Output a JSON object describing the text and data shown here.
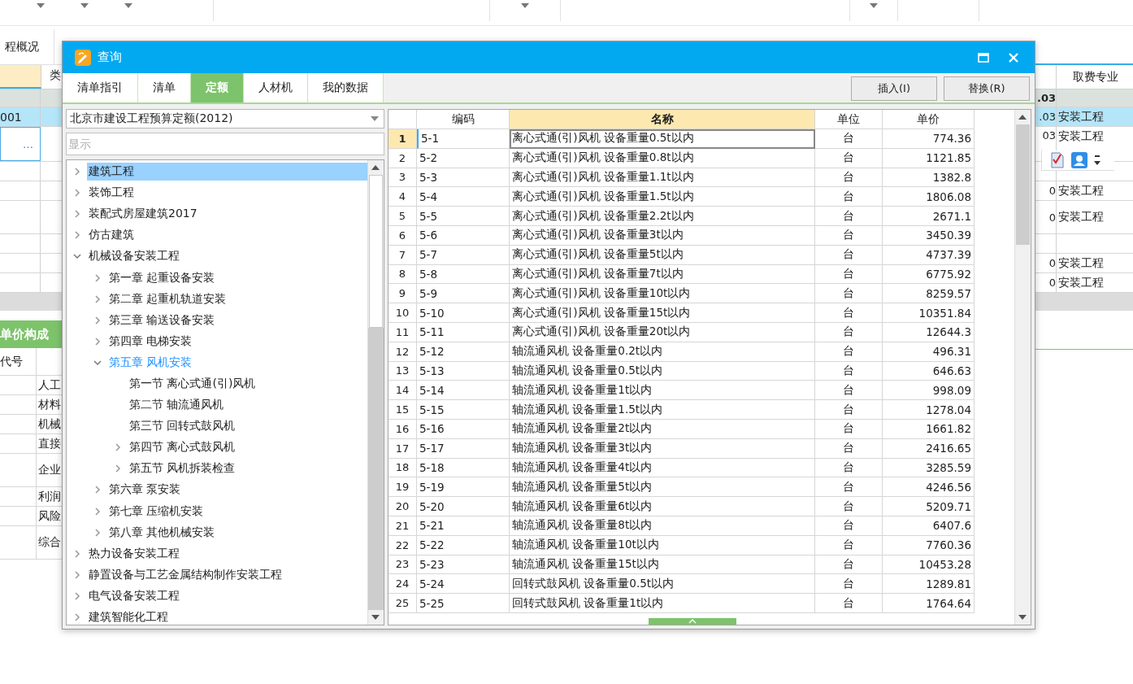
{
  "background": {
    "tab": "程概况",
    "left_header": "类",
    "right_header": "取费专业",
    "rows": [
      {
        "kind": "group",
        "selected": false,
        "right_number": ".03"
      },
      {
        "kind": "item",
        "selected": true,
        "left_cell": "001",
        "right_number": ".03",
        "right_specialty": "安装工程"
      },
      {
        "kind": "edit",
        "selected": false,
        "left_cell": "…",
        "right_number": "03",
        "right_specialty": "安装工程"
      },
      {
        "kind": "item",
        "selected": false
      },
      {
        "kind": "item",
        "selected": false,
        "right_number": "0",
        "right_specialty": "安装工程"
      },
      {
        "kind": "tall",
        "selected": false,
        "right_number": "0",
        "right_specialty": "安装工程"
      },
      {
        "kind": "item",
        "selected": false
      },
      {
        "kind": "item",
        "selected": false,
        "right_number": "0",
        "right_specialty": "安装工程"
      },
      {
        "kind": "item",
        "selected": false,
        "right_number": "0",
        "right_specialty": "安装工程"
      }
    ],
    "panel": {
      "title": "单价构成",
      "header": "代号",
      "rows": [
        {
          "label": "人工",
          "kind": "item"
        },
        {
          "label": "材料",
          "kind": "item"
        },
        {
          "label": "机械",
          "kind": "item"
        },
        {
          "label": "直接",
          "kind": "item"
        },
        {
          "label": "企业",
          "kind": "tall"
        },
        {
          "label": "利润",
          "kind": "item"
        },
        {
          "label": "风险",
          "kind": "item"
        },
        {
          "label": "综合",
          "kind": "tall"
        }
      ]
    }
  },
  "dialog": {
    "title": "查询",
    "tabs": [
      {
        "label": "清单指引",
        "selected": false
      },
      {
        "label": "清单",
        "selected": false
      },
      {
        "label": "定额",
        "selected": true
      },
      {
        "label": "人材机",
        "selected": false
      },
      {
        "label": "我的数据",
        "selected": false
      }
    ],
    "buttons": [
      "插入(I)",
      "替换(R)"
    ],
    "quota_set": "北京市建设工程预算定额(2012)",
    "search": {
      "placeholder": "显示"
    },
    "tree": {
      "items": [
        {
          "label": "建筑工程",
          "kind": "folder",
          "expanded": false,
          "selected": true,
          "current": false
        },
        {
          "label": "装饰工程",
          "kind": "folder",
          "expanded": false,
          "selected": false,
          "current": false
        },
        {
          "label": "装配式房屋建筑2017",
          "kind": "folder",
          "expanded": false,
          "selected": false,
          "current": false
        },
        {
          "label": "仿古建筑",
          "kind": "folder",
          "expanded": false,
          "selected": false,
          "current": false
        },
        {
          "label": "机械设备安装工程",
          "kind": "folder",
          "expanded": true,
          "selected": false,
          "current": false,
          "children": [
            {
              "label": "第一章 起重设备安装",
              "kind": "folder",
              "expanded": false,
              "selected": false,
              "current": false
            },
            {
              "label": "第二章 起重机轨道安装",
              "kind": "folder",
              "expanded": false,
              "selected": false,
              "current": false
            },
            {
              "label": "第三章 输送设备安装",
              "kind": "folder",
              "expanded": false,
              "selected": false,
              "current": false
            },
            {
              "label": "第四章 电梯安装",
              "kind": "folder",
              "expanded": false,
              "selected": false,
              "current": false
            },
            {
              "label": "第五章 风机安装",
              "kind": "folder",
              "expanded": true,
              "selected": false,
              "current": true,
              "children": [
                {
                  "label": "第一节 离心式通(引)风机",
                  "kind": "leaf",
                  "expanded": false,
                  "selected": false,
                  "current": false
                },
                {
                  "label": "第二节 轴流通风机",
                  "kind": "leaf",
                  "expanded": false,
                  "selected": false,
                  "current": false
                },
                {
                  "label": "第三节 回转式鼓风机",
                  "kind": "leaf",
                  "expanded": false,
                  "selected": false,
                  "current": false
                },
                {
                  "label": "第四节 离心式鼓风机",
                  "kind": "folder",
                  "expanded": false,
                  "selected": false,
                  "current": false
                },
                {
                  "label": "第五节 风机拆装检查",
                  "kind": "folder",
                  "expanded": false,
                  "selected": false,
                  "current": false
                }
              ]
            },
            {
              "label": "第六章 泵安装",
              "kind": "folder",
              "expanded": false,
              "selected": false,
              "current": false
            },
            {
              "label": "第七章 压缩机安装",
              "kind": "folder",
              "expanded": false,
              "selected": false,
              "current": false
            },
            {
              "label": "第八章 其他机械安装",
              "kind": "folder",
              "expanded": false,
              "selected": false,
              "current": false
            }
          ]
        },
        {
          "label": "热力设备安装工程",
          "kind": "folder",
          "expanded": false,
          "selected": false,
          "current": false
        },
        {
          "label": "静置设备与工艺金属结构制作安装工程",
          "kind": "folder",
          "expanded": false,
          "selected": false,
          "current": false
        },
        {
          "label": "电气设备安装工程",
          "kind": "folder",
          "expanded": false,
          "selected": false,
          "current": false
        },
        {
          "label": "建筑智能化工程",
          "kind": "folder",
          "expanded": false,
          "selected": false,
          "current": false
        }
      ]
    },
    "table": {
      "columns": [
        {
          "label": "编码",
          "selected": false
        },
        {
          "label": "名称",
          "selected": true
        },
        {
          "label": "单位",
          "selected": false
        },
        {
          "label": "单价",
          "selected": false
        }
      ],
      "rows": [
        {
          "number": "1",
          "code": "5-1",
          "name": "离心式通(引)风机 设备重量0.5t以内",
          "unit": "台",
          "price": "774.36",
          "selected": true
        },
        {
          "number": "2",
          "code": "5-2",
          "name": "离心式通(引)风机 设备重量0.8t以内",
          "unit": "台",
          "price": "1121.85",
          "selected": false
        },
        {
          "number": "3",
          "code": "5-3",
          "name": "离心式通(引)风机 设备重量1.1t以内",
          "unit": "台",
          "price": "1382.8",
          "selected": false
        },
        {
          "number": "4",
          "code": "5-4",
          "name": "离心式通(引)风机 设备重量1.5t以内",
          "unit": "台",
          "price": "1806.08",
          "selected": false
        },
        {
          "number": "5",
          "code": "5-5",
          "name": "离心式通(引)风机 设备重量2.2t以内",
          "unit": "台",
          "price": "2671.1",
          "selected": false
        },
        {
          "number": "6",
          "code": "5-6",
          "name": "离心式通(引)风机 设备重量3t以内",
          "unit": "台",
          "price": "3450.39",
          "selected": false
        },
        {
          "number": "7",
          "code": "5-7",
          "name": "离心式通(引)风机 设备重量5t以内",
          "unit": "台",
          "price": "4737.39",
          "selected": false
        },
        {
          "number": "8",
          "code": "5-8",
          "name": "离心式通(引)风机 设备重量7t以内",
          "unit": "台",
          "price": "6775.92",
          "selected": false
        },
        {
          "number": "9",
          "code": "5-9",
          "name": "离心式通(引)风机 设备重量10t以内",
          "unit": "台",
          "price": "8259.57",
          "selected": false
        },
        {
          "number": "10",
          "code": "5-10",
          "name": "离心式通(引)风机 设备重量15t以内",
          "unit": "台",
          "price": "10351.84",
          "selected": false
        },
        {
          "number": "11",
          "code": "5-11",
          "name": "离心式通(引)风机 设备重量20t以内",
          "unit": "台",
          "price": "12644.3",
          "selected": false
        },
        {
          "number": "12",
          "code": "5-12",
          "name": "轴流通风机 设备重量0.2t以内",
          "unit": "台",
          "price": "496.31",
          "selected": false
        },
        {
          "number": "13",
          "code": "5-13",
          "name": "轴流通风机 设备重量0.5t以内",
          "unit": "台",
          "price": "646.63",
          "selected": false
        },
        {
          "number": "14",
          "code": "5-14",
          "name": "轴流通风机 设备重量1t以内",
          "unit": "台",
          "price": "998.09",
          "selected": false
        },
        {
          "number": "15",
          "code": "5-15",
          "name": "轴流通风机 设备重量1.5t以内",
          "unit": "台",
          "price": "1278.04",
          "selected": false
        },
        {
          "number": "16",
          "code": "5-16",
          "name": "轴流通风机 设备重量2t以内",
          "unit": "台",
          "price": "1661.82",
          "selected": false
        },
        {
          "number": "17",
          "code": "5-17",
          "name": "轴流通风机 设备重量3t以内",
          "unit": "台",
          "price": "2416.65",
          "selected": false
        },
        {
          "number": "18",
          "code": "5-18",
          "name": "轴流通风机 设备重量4t以内",
          "unit": "台",
          "price": "3285.59",
          "selected": false
        },
        {
          "number": "19",
          "code": "5-19",
          "name": "轴流通风机 设备重量5t以内",
          "unit": "台",
          "price": "4246.56",
          "selected": false
        },
        {
          "number": "20",
          "code": "5-20",
          "name": "轴流通风机 设备重量6t以内",
          "unit": "台",
          "price": "5209.71",
          "selected": false
        },
        {
          "number": "21",
          "code": "5-21",
          "name": "轴流通风机 设备重量8t以内",
          "unit": "台",
          "price": "6407.6",
          "selected": false
        },
        {
          "number": "22",
          "code": "5-22",
          "name": "轴流通风机 设备重量10t以内",
          "unit": "台",
          "price": "7760.36",
          "selected": false
        },
        {
          "number": "23",
          "code": "5-23",
          "name": "轴流通风机 设备重量15t以内",
          "unit": "台",
          "price": "10453.28",
          "selected": false
        },
        {
          "number": "24",
          "code": "5-24",
          "name": "回转式鼓风机 设备重量0.5t以内",
          "unit": "台",
          "price": "1289.81",
          "selected": false
        },
        {
          "number": "25",
          "code": "5-25",
          "name": "回转式鼓风机 设备重量1t以内",
          "unit": "台",
          "price": "1764.64",
          "selected": false
        }
      ]
    }
  }
}
